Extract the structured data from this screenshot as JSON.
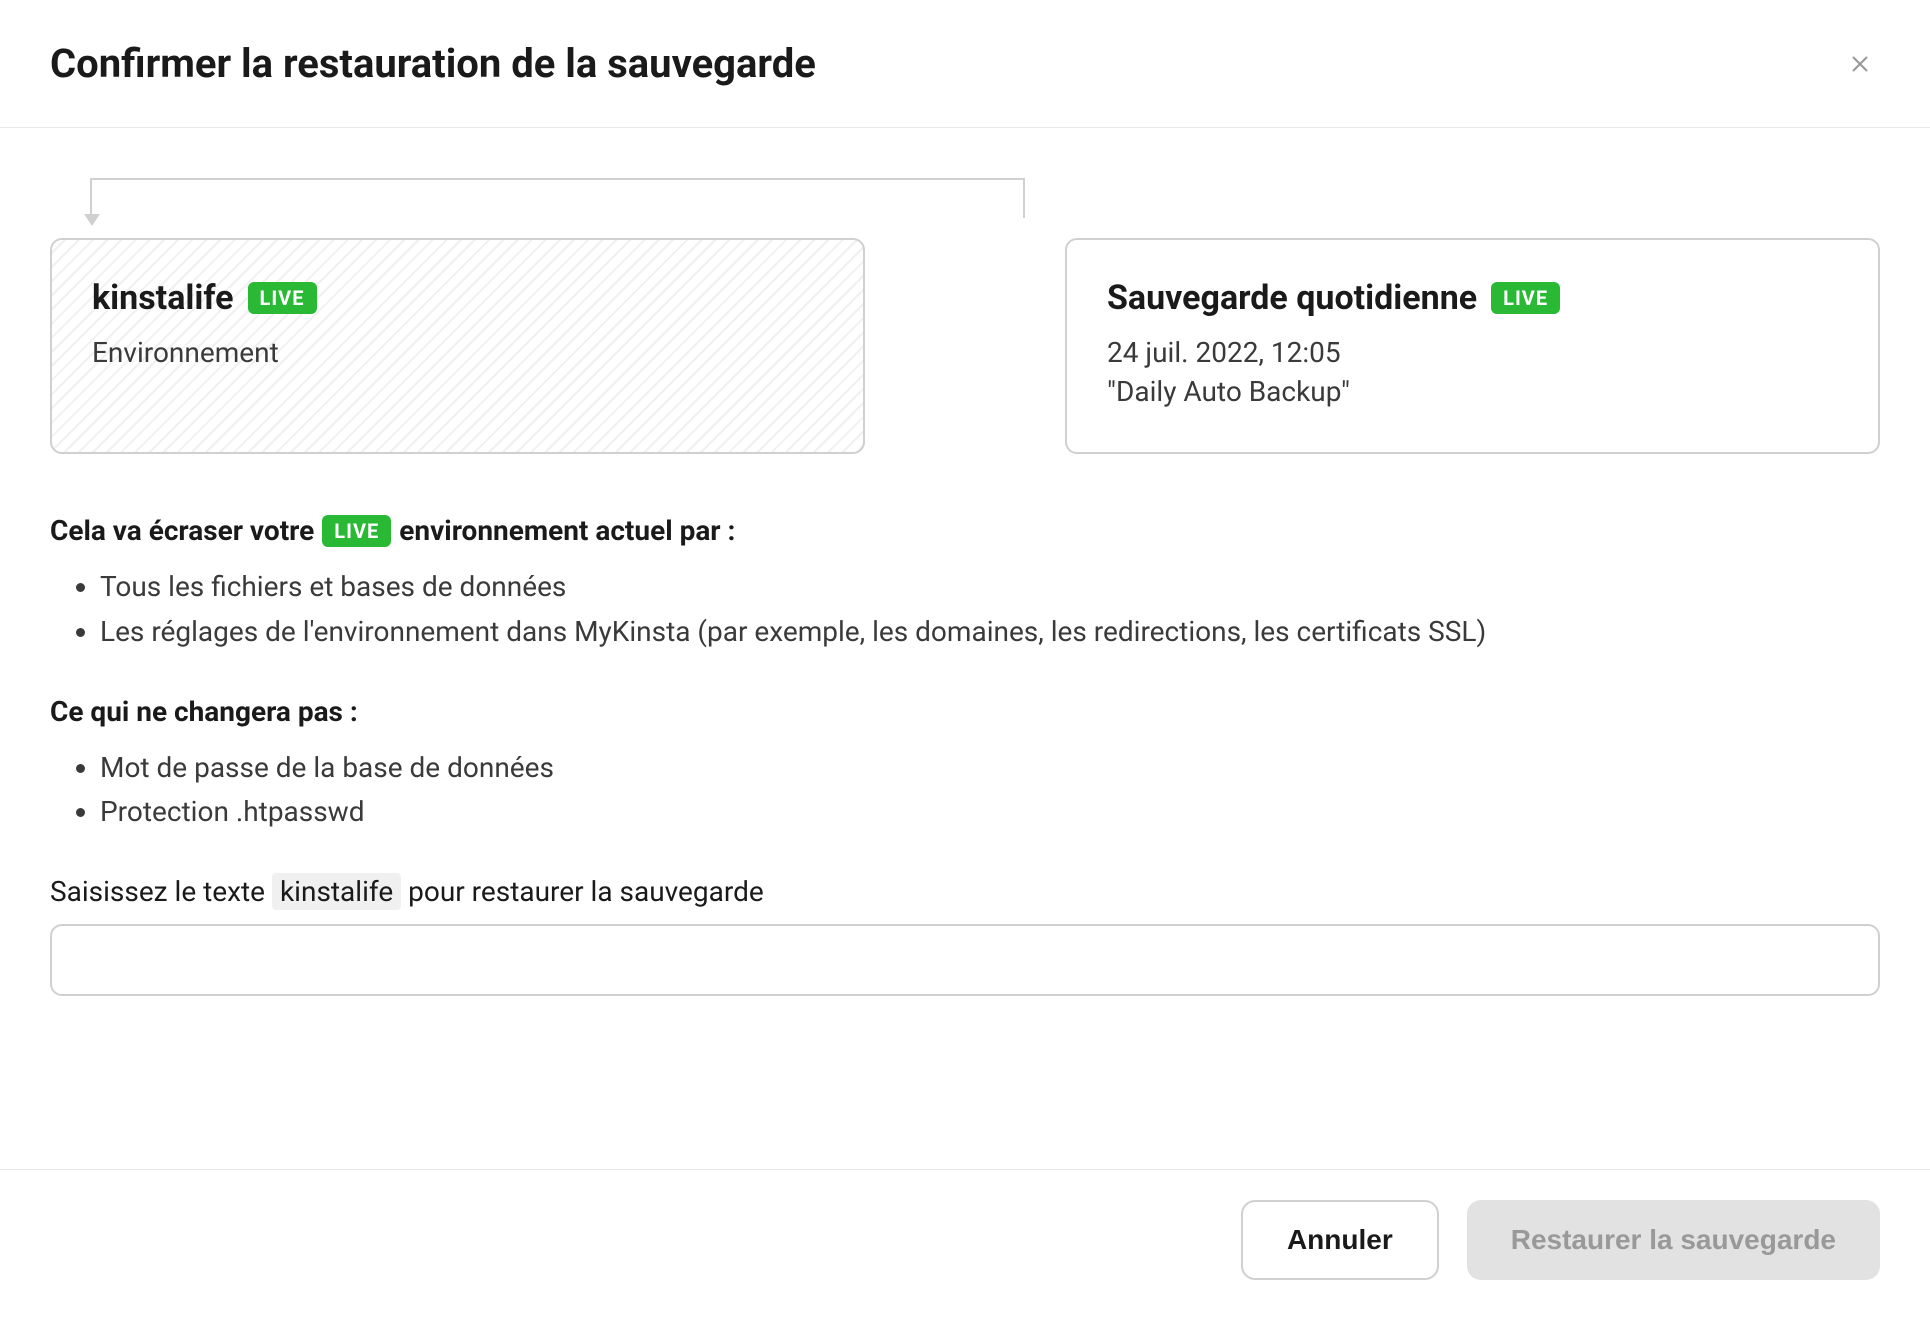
{
  "header": {
    "title": "Confirmer la restauration de la sauvegarde"
  },
  "cards": {
    "target": {
      "name": "kinstalife",
      "badge": "LIVE",
      "subtitle": "Environnement"
    },
    "source": {
      "title": "Sauvegarde quotidienne",
      "badge": "LIVE",
      "date": "24 juil. 2022, 12:05",
      "description": "\"Daily Auto Backup\""
    }
  },
  "overwrite": {
    "prefix": "Cela va écraser votre",
    "badge": "LIVE",
    "suffix": "environnement actuel par :",
    "items": [
      "Tous les fichiers et bases de données",
      "Les réglages de l'environnement dans MyKinsta (par exemple, les domaines, les redirections, les certificats SSL)"
    ]
  },
  "unchanged": {
    "heading": "Ce qui ne changera pas :",
    "items": [
      "Mot de passe de la base de données",
      "Protection .htpasswd"
    ]
  },
  "confirm": {
    "prefix": "Saisissez le texte",
    "keyword": "kinstalife",
    "suffix": "pour restaurer la sauvegarde"
  },
  "footer": {
    "cancel": "Annuler",
    "restore": "Restaurer la sauvegarde"
  }
}
